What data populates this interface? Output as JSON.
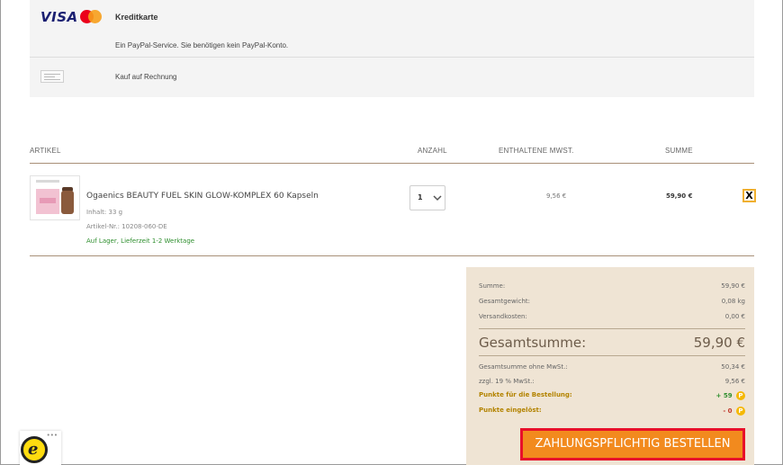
{
  "payment": {
    "card_brand": "VISA",
    "card_label": "Kreditkarte",
    "paypal_note": "Ein PayPal-Service. Sie benötigen kein PayPal-Konto.",
    "invoice_label": "Kauf auf Rechnung"
  },
  "table": {
    "headers": {
      "artikel": "ARTIKEL",
      "anzahl": "ANZAHL",
      "mwst": "ENTHALTENE MWST.",
      "summe": "SUMME"
    }
  },
  "item": {
    "name": "Ogaenics BEAUTY FUEL SKIN GLOW-KOMPLEX 60 Kapseln",
    "content": "Inhalt: 33 g",
    "article_no": "Artikel-Nr.: 10208-060-DE",
    "stock": "Auf Lager, Lieferzeit 1-2 Werktage",
    "quantity": "1",
    "vat": "9,56 €",
    "sum": "59,90 €",
    "remove": "X"
  },
  "summary": {
    "summe_label": "Summe:",
    "summe_value": "59,90 €",
    "gewicht_label": "Gesamtgewicht:",
    "gewicht_value": "0,08 kg",
    "versand_label": "Versandkosten:",
    "versand_value": "0,00 €",
    "total_label": "Gesamtsumme:",
    "total_value": "59,90 €",
    "netto_label": "Gesamtsumme ohne MwSt.:",
    "netto_value": "50,34 €",
    "mwst_label": "zzgl. 19 % MwSt.:",
    "mwst_value": "9,56 €",
    "punkte_label": "Punkte für die Bestellung:",
    "punkte_value": "+ 59",
    "eingeloest_label": "Punkte eingelöst:",
    "eingeloest_value": "- 0",
    "coin": "P"
  },
  "order_button": "ZAHLUNGSPFLICHTIG BESTELLEN",
  "colors": {
    "accent_orange": "#f28a1e",
    "button_border": "#e8102a",
    "summary_bg": "#efe4d4",
    "stock_green": "#2f8f2f"
  }
}
